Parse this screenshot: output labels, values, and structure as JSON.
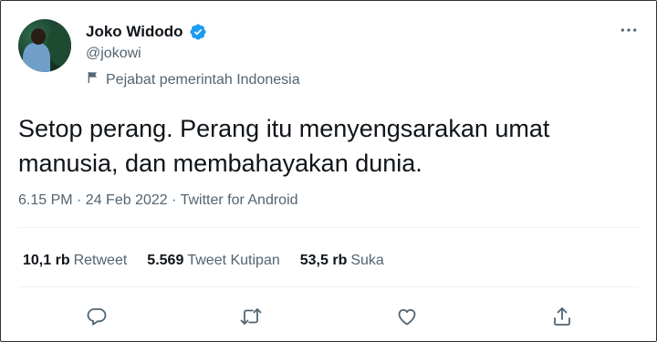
{
  "author": {
    "display_name": "Joko Widodo",
    "handle": "@jokowi",
    "verified": true,
    "label": "Pejabat pemerintah Indonesia"
  },
  "tweet": {
    "text": "Setop perang. Perang itu menyengsarakan umat\nmanusia, dan membahayakan dunia.",
    "meta": "6.15 PM · 24 Feb 2022 · Twitter for Android"
  },
  "stats": [
    {
      "count": "10,1 rb",
      "label": "Retweet"
    },
    {
      "count": "5.569",
      "label": "Tweet Kutipan"
    },
    {
      "count": "53,5 rb",
      "label": "Suka"
    }
  ],
  "actions": [
    "reply-icon",
    "retweet-icon",
    "like-icon",
    "share-icon"
  ],
  "colors": {
    "primary_text": "#0f1419",
    "secondary_text": "#536471",
    "verified_blue": "#1d9bf0",
    "divider": "#eff3f4"
  }
}
